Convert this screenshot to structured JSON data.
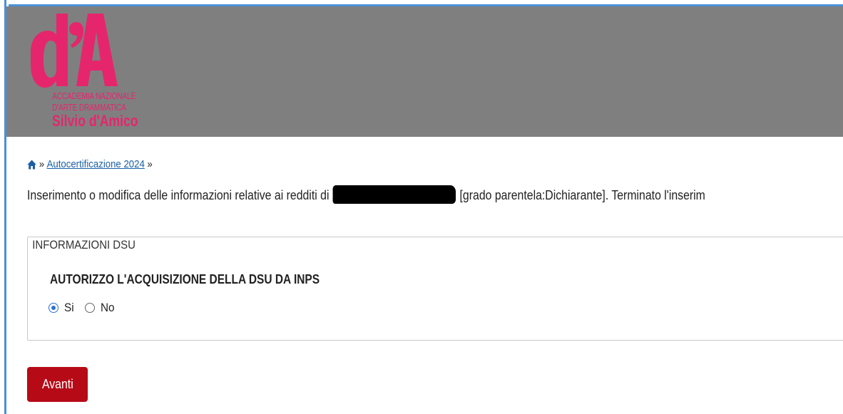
{
  "logo": {
    "monogram": "d'A",
    "line1": "ACCADEMIA NAZIONALE",
    "line2": "D'ARTE DRAMMATICA",
    "line3": "Silvio d'Amico",
    "color": "#e5266c"
  },
  "colors": {
    "header_bg": "#7f7f7f",
    "accent_blue": "#2b6fd6",
    "button_red": "#b70a17",
    "link": "#1a5fa8"
  },
  "breadcrumb": {
    "home_icon": "home-icon",
    "sep1": "»",
    "link": "Autocertificazione 2024",
    "sep2": "»"
  },
  "intro": {
    "before": "Inserimento o modifica delle informazioni relative ai redditi di",
    "after": "[grado parentela:Dichiarante]. Terminato l'inserim"
  },
  "dsu": {
    "legend": "INFORMAZIONI DSU",
    "question": "AUTORIZZO L'ACQUISIZIONE DELLA DSU DA INPS",
    "options": [
      {
        "label": "Si",
        "checked": true
      },
      {
        "label": "No",
        "checked": false
      }
    ]
  },
  "actions": {
    "next_label": "Avanti"
  }
}
